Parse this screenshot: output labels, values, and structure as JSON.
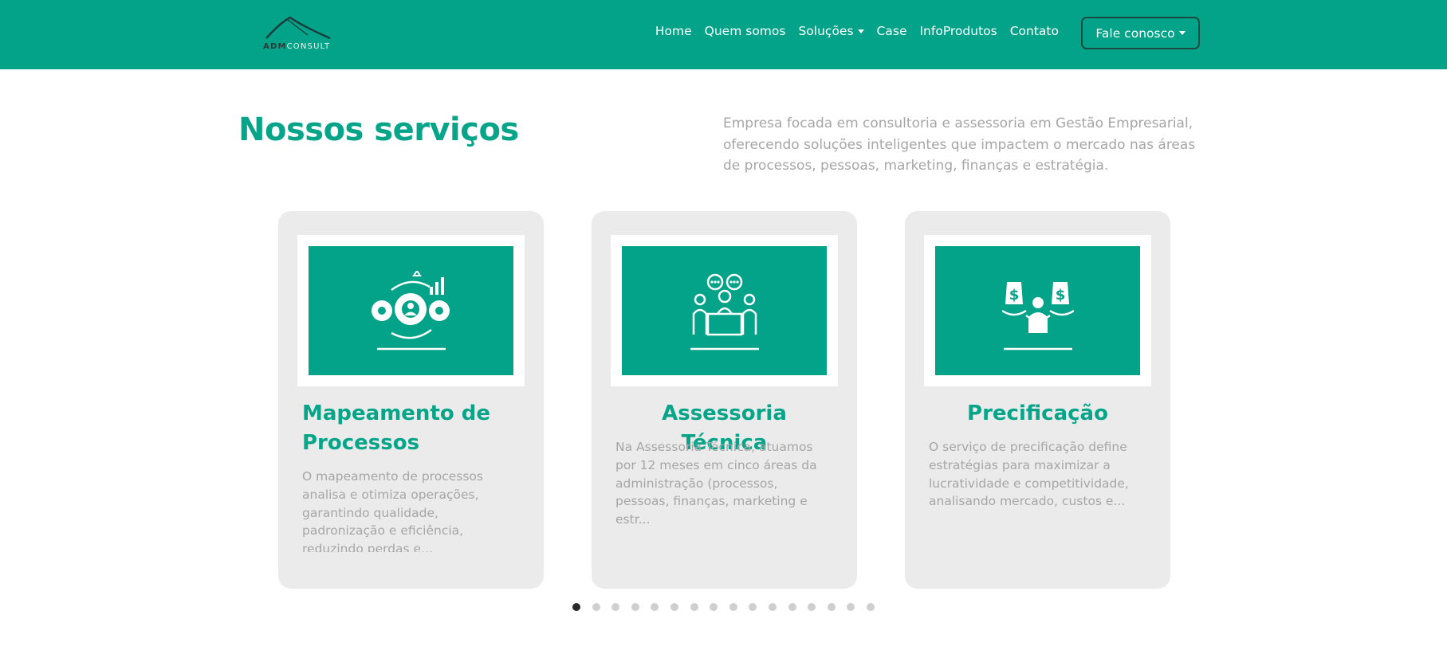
{
  "header": {
    "logo": {
      "prefix": "ADM",
      "suffix": "CONSULT"
    },
    "nav": [
      "Home",
      "Quem somos",
      "Soluções",
      "Case",
      "InfoProdutos",
      "Contato"
    ],
    "cta_label": "Fale conosco",
    "brand_color": "#02a388"
  },
  "section": {
    "title": "Nossos serviços",
    "description": "Empresa focada em consultoria e assessoria em Gestão Empresarial, oferecendo soluções inteligentes que impactem o mercado nas áreas de processos, pessoas, marketing, finanças e estratégia."
  },
  "cards": [
    {
      "icon": "gears-process-icon",
      "title": "Mapeamento de Processos",
      "text": "O mapeamento de processos analisa e otimiza operações, garantindo qualidade, padronização e eficiência, reduzindo perdas e..."
    },
    {
      "icon": "meeting-people-icon",
      "title": "Assessoria Técnica",
      "text": "Na Assessoria Técnica, atuamos por 12 meses em cinco áreas da administração (processos, pessoas, finanças, marketing e estr..."
    },
    {
      "icon": "price-scale-icon",
      "title": "Precificação",
      "text": "O serviço de precificação define estratégias para maximizar a lucratividade e competitividade, analisando mercado, custos e..."
    }
  ],
  "carousel": {
    "total_slides": 16,
    "active_index": 0
  }
}
